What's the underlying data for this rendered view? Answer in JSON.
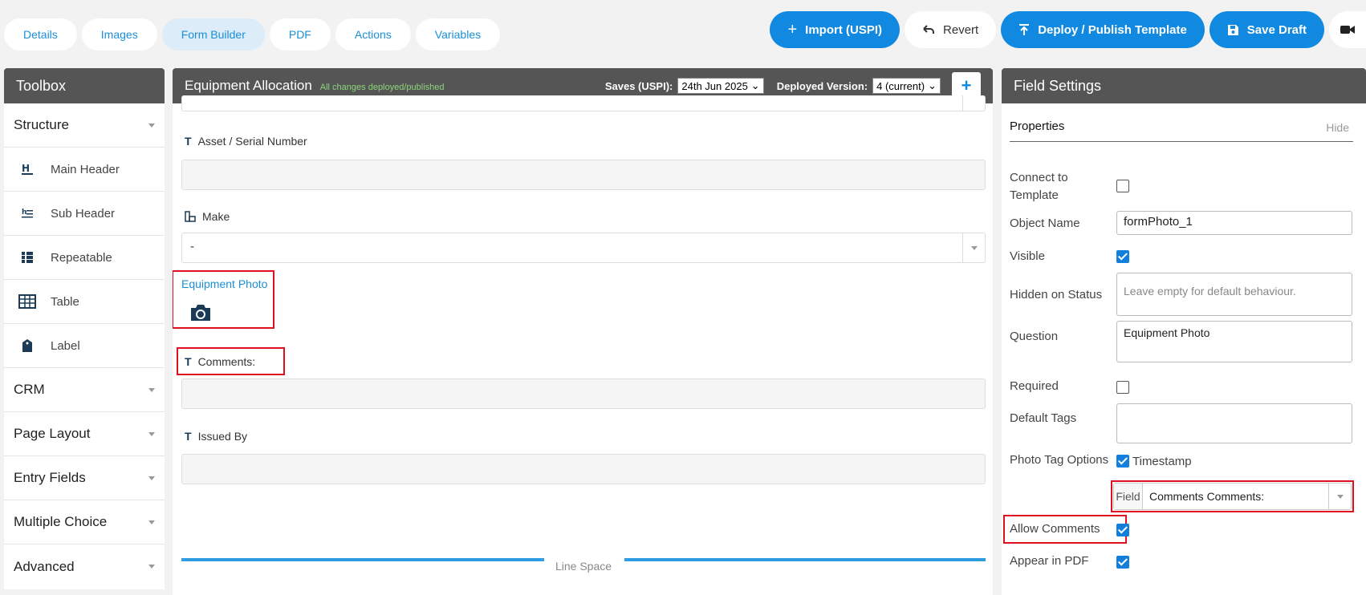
{
  "tabs": [
    "Details",
    "Images",
    "Form Builder",
    "PDF",
    "Actions",
    "Variables"
  ],
  "active_tab": "Form Builder",
  "toolbar": {
    "import_label": "Import (USPI)",
    "revert_label": "Revert",
    "deploy_label": "Deploy / Publish Template",
    "save_label": "Save Draft"
  },
  "toolbox": {
    "title": "Toolbox",
    "structure_label": "Structure",
    "structure_items": [
      "Main Header",
      "Sub Header",
      "Repeatable",
      "Table",
      "Label"
    ],
    "sections": [
      "CRM",
      "Page Layout",
      "Entry Fields",
      "Multiple Choice",
      "Advanced"
    ]
  },
  "form": {
    "title": "Equipment Allocation",
    "status": "All changes deployed/published",
    "saves_label": "Saves (USPI):",
    "saves_value": "24th Jun 2025",
    "deployed_label": "Deployed Version:",
    "deployed_value": "4 (current)",
    "add_label": "+",
    "fields": {
      "asset": "Asset / Serial Number",
      "make": "Make",
      "make_value": "-",
      "photo": "Equipment Photo",
      "comments": "Comments:",
      "issued_by": "Issued By",
      "line_space": "Line Space"
    }
  },
  "settings": {
    "title": "Field Settings",
    "properties_tab": "Properties",
    "hide_label": "Hide",
    "connect_label": "Connect to Template",
    "object_name_label": "Object Name",
    "object_name_value": "formPhoto_1",
    "visible_label": "Visible",
    "hidden_status_label": "Hidden on Status",
    "hidden_status_placeholder": "Leave empty for default behaviour.",
    "question_label": "Question",
    "question_value": "Equipment  Photo",
    "required_label": "Required",
    "default_tags_label": "Default Tags",
    "photo_tag_label": "Photo Tag Options",
    "timestamp_label": "Timestamp",
    "field_label": "Field",
    "field_value": "Comments Comments:",
    "allow_comments_label": "Allow Comments",
    "appear_pdf_label": "Appear in PDF",
    "checks": {
      "connect": false,
      "visible": true,
      "required": false,
      "timestamp": true,
      "allow_comments": true,
      "appear_pdf": true
    }
  },
  "colors": {
    "accent": "#1189e0",
    "header": "#555555",
    "highlight": "#e0101e",
    "status": "#8bd47a"
  }
}
